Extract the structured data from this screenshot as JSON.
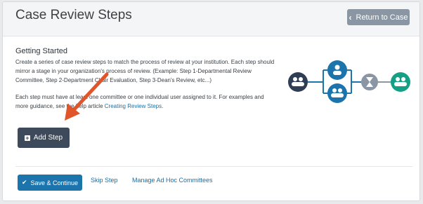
{
  "header": {
    "title": "Case Review Steps",
    "return_label": "Return to Case"
  },
  "intro": {
    "heading": "Getting Started",
    "paragraph1": "Create a series of case review steps to match the process of review at your institution. Each step should mirror a stage in your organization's process of review. (Example: Step 1-Departmental Review Committee, Step 2-Department Chair Evaluation, Step 3-Dean's Review, etc...)",
    "paragraph2_text": "Each step must have at least one committee or one individual user assigned to it. For examples and more guidance, see the help article ",
    "paragraph2_link": "Creating Review Steps",
    "paragraph2_end": "."
  },
  "actions": {
    "add_step_label": "Add Step",
    "save_label": "Save & Continue",
    "skip_label": "Skip Step",
    "manage_label": "Manage Ad Hoc Committees"
  },
  "icons": {
    "return": "chevron-left-icon",
    "add": "plus-square-icon",
    "save": "check-icon",
    "workflow": [
      "group-icon",
      "person-icon",
      "group-icon",
      "hourglass-icon",
      "group-icon"
    ]
  },
  "colors": {
    "primary": "#1c74ad",
    "dark_button": "#3d4a5c",
    "return_button": "#8a96a3",
    "node_dark": "#2f3d55",
    "node_blue": "#1c74ad",
    "node_gray": "#8a96a3",
    "node_teal": "#14a085",
    "annotation_arrow": "#e1552a"
  }
}
